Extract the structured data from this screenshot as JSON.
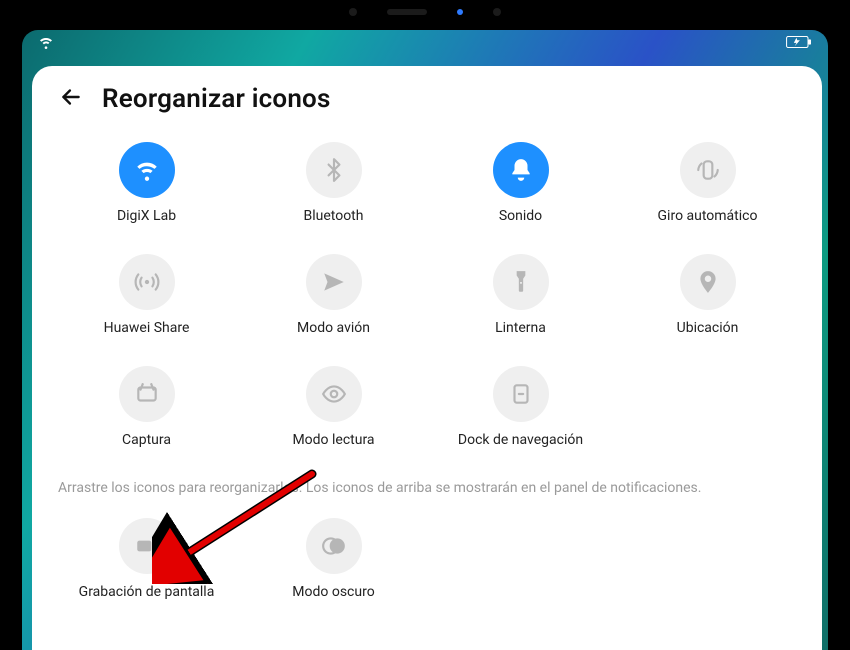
{
  "header": {
    "title": "Reorganizar iconos"
  },
  "tiles": [
    {
      "icon": "wifi",
      "label": "DigiX Lab",
      "active": true
    },
    {
      "icon": "bluetooth",
      "label": "Bluetooth",
      "active": false
    },
    {
      "icon": "bell",
      "label": "Sonido",
      "active": true
    },
    {
      "icon": "rotate",
      "label": "Giro automático",
      "active": false
    },
    {
      "icon": "broadcast",
      "label": "Huawei Share",
      "active": false
    },
    {
      "icon": "airplane",
      "label": "Modo avión",
      "active": false
    },
    {
      "icon": "flashlight",
      "label": "Linterna",
      "active": false
    },
    {
      "icon": "location",
      "label": "Ubicación",
      "active": false
    },
    {
      "icon": "capture",
      "label": "Captura",
      "active": false
    },
    {
      "icon": "eye",
      "label": "Modo lectura",
      "active": false
    },
    {
      "icon": "dock",
      "label": "Dock de navegación",
      "active": false
    }
  ],
  "hint": "Arrastre los iconos para reorganizarlos. Los iconos de arriba se mostrarán en el panel de notificaciones.",
  "secondary_tiles": [
    {
      "icon": "record",
      "label": "Grabación de pantalla",
      "active": false
    },
    {
      "icon": "darkmode",
      "label": "Modo oscuro",
      "active": false
    }
  ],
  "colors": {
    "accent": "#1e90ff",
    "tile_bg": "#efefef",
    "hint": "#9a9a9a"
  },
  "annotation": {
    "arrow_target": "record"
  }
}
